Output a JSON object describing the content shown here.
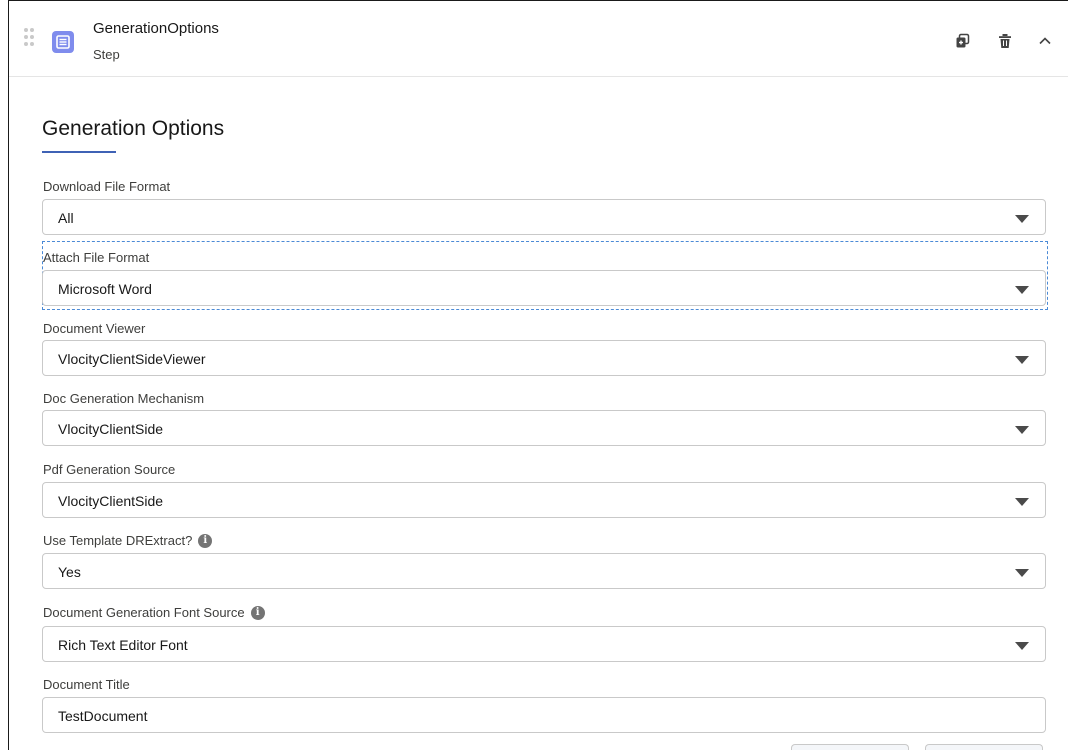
{
  "step": {
    "title": "GenerationOptions",
    "subtitle": "Step",
    "icon": "list-icon",
    "actions": [
      "copy-icon",
      "trash-icon",
      "chevron-up-icon"
    ]
  },
  "section": {
    "title": "Generation Options",
    "accent_color": "#3f62b5"
  },
  "fields": {
    "download_format": {
      "label": "Download File Format",
      "value": "All"
    },
    "attach_format": {
      "label": "Attach File Format",
      "value": "Microsoft Word"
    },
    "doc_viewer": {
      "label": "Document Viewer",
      "value": "VlocityClientSideViewer"
    },
    "doc_mechanism": {
      "label": "Doc Generation Mechanism",
      "value": "VlocityClientSide"
    },
    "pdf_source": {
      "label": "Pdf Generation Source",
      "value": "VlocityClientSide"
    },
    "template_drextract": {
      "label": "Use Template DRExtract?",
      "value": "Yes"
    },
    "font_source": {
      "label": "Document Generation Font Source",
      "value": "Rich Text Editor Font"
    },
    "doc_title": {
      "label": "Document Title",
      "value": "TestDocument"
    }
  }
}
